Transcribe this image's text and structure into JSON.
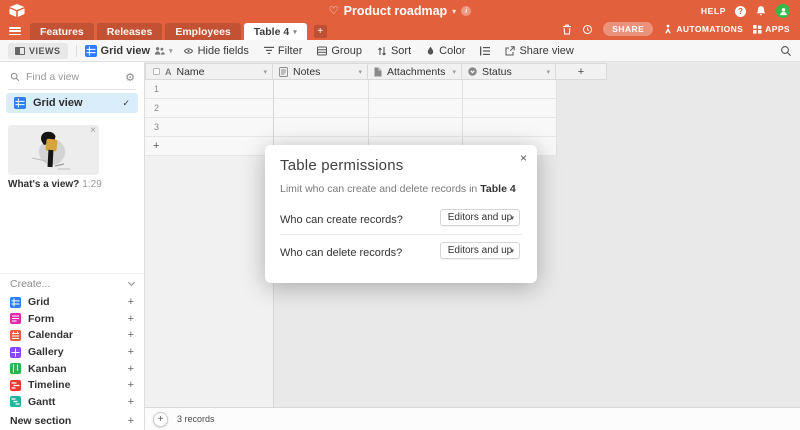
{
  "topbar": {
    "title": "Product roadmap",
    "help": "HELP",
    "share": "SHARE",
    "automations": "AUTOMATIONS",
    "apps": "APPS",
    "tabs": [
      {
        "label": "Features"
      },
      {
        "label": "Releases"
      },
      {
        "label": "Employees"
      },
      {
        "label": "Table 4"
      }
    ],
    "accent_color": "#e2603c",
    "avatar_color": "#35ba49"
  },
  "toolbar": {
    "views": "VIEWS",
    "view_name": "Grid view",
    "hide_fields": "Hide fields",
    "filter": "Filter",
    "group": "Group",
    "sort": "Sort",
    "color": "Color",
    "share_view": "Share view"
  },
  "sidebar": {
    "search_placeholder": "Find a view",
    "selected_view": "Grid view",
    "video_caption": "What's a view?",
    "video_duration": "1:29",
    "create_label": "Create...",
    "create_items": [
      {
        "label": "Grid",
        "color": "#2d7ff9"
      },
      {
        "label": "Form",
        "color": "#e529ab"
      },
      {
        "label": "Calendar",
        "color": "#ec5a43"
      },
      {
        "label": "Gallery",
        "color": "#8b46ff"
      },
      {
        "label": "Kanban",
        "color": "#2eb350"
      },
      {
        "label": "Timeline",
        "color": "#ee3b2f"
      },
      {
        "label": "Gantt",
        "color": "#22b5a0"
      }
    ],
    "new_section": "New section"
  },
  "table": {
    "columns": [
      {
        "label": "Name"
      },
      {
        "label": "Notes"
      },
      {
        "label": "Attachments"
      },
      {
        "label": "Status"
      }
    ],
    "row_numbers": [
      "1",
      "2",
      "3"
    ],
    "record_count": "3 records"
  },
  "modal": {
    "title": "Table permissions",
    "subtitle_prefix": "Limit who can create and delete records in",
    "subtitle_table": "Table 4",
    "create_question": "Who can create records?",
    "delete_question": "Who can delete records?",
    "create_value": "Editors and up",
    "delete_value": "Editors and up"
  },
  "icons": {
    "heart": "♡",
    "caret_down": "▾",
    "info": "i",
    "help_q": "?",
    "plus": "+",
    "close": "×",
    "check": "✓",
    "gear": "⚙",
    "name_field": "A"
  }
}
